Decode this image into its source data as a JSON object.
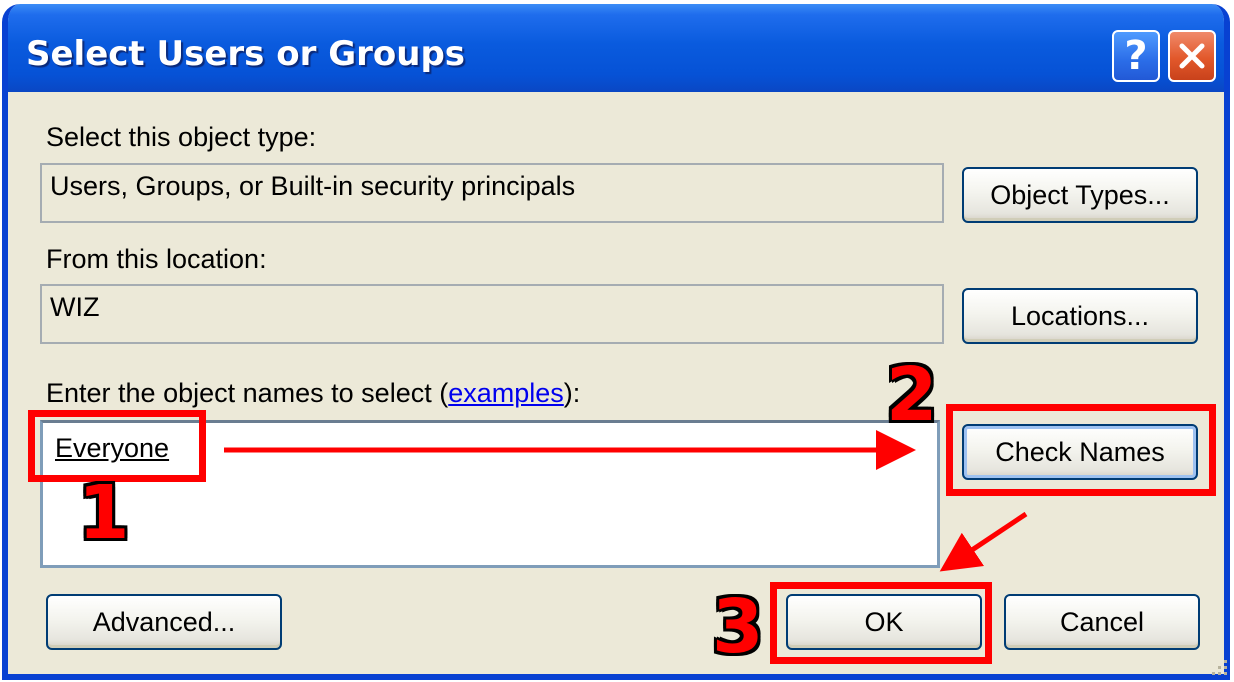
{
  "window": {
    "title": "Select Users or Groups",
    "help_icon": "help-icon",
    "close_icon": "close-icon"
  },
  "object_type": {
    "label": "Select this object type:",
    "value": "Users, Groups, or Built-in security principals",
    "button": "Object Types..."
  },
  "location": {
    "label": "From this location:",
    "value": "WIZ",
    "button": "Locations..."
  },
  "names": {
    "label_prefix": "Enter the object names to select (",
    "label_link": "examples",
    "label_suffix": "):",
    "value": "Everyone",
    "check_button": "Check Names"
  },
  "footer": {
    "advanced_button": "Advanced...",
    "ok_button": "OK",
    "cancel_button": "Cancel"
  },
  "annotations": {
    "step1": "1",
    "step2": "2",
    "step3": "3",
    "color": "#ff0000"
  }
}
